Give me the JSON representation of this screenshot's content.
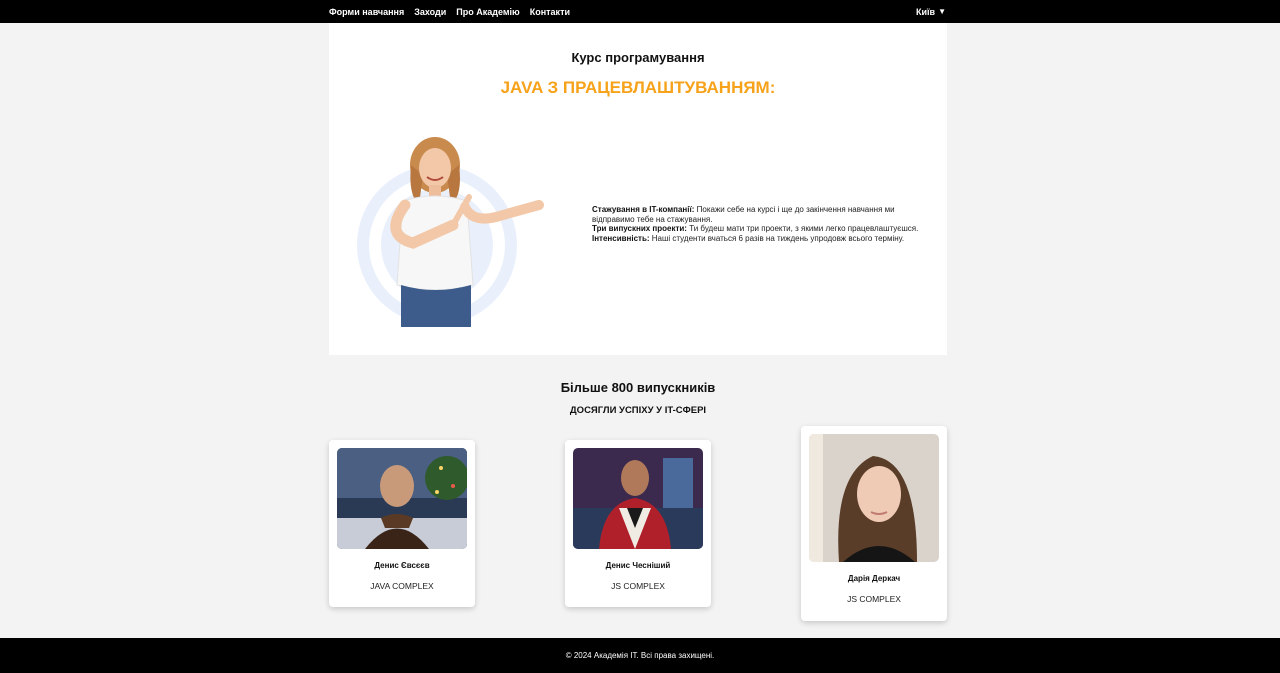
{
  "nav": {
    "items": [
      "Форми навчання",
      "Заходи",
      "Про Академію",
      "Контакти"
    ],
    "city": "Київ",
    "caret": "▼"
  },
  "hero": {
    "subtitle": "Курс програмування",
    "title": "JAVA З ПРАЦЕВЛАШТУВАННЯМ:",
    "features": [
      {
        "label": "Стажування в IT-компанії:",
        "text": " Покажи себе на курсі і ще до закінчення навчання ми відправимо тебе на стажування."
      },
      {
        "label": "Три випускних проекти:",
        "text": " Ти будеш мати три проекти, з якими легко працевлаштуєшся."
      },
      {
        "label": "Інтенсивність:",
        "text": " Наші студенти вчаться 6 разів на тиждень упродовж всього терміну."
      }
    ]
  },
  "graduates": {
    "title": "Більше 800 випускників",
    "subtitle": "ДОСЯГЛИ УСПІХУ У IT-СФЕРІ",
    "cards": [
      {
        "name": "Денис Євсєєв",
        "course": "JAVA COMPLEX"
      },
      {
        "name": "Денис Чесніший",
        "course": "JS COMPLEX"
      },
      {
        "name": "Дарія Деркач",
        "course": "JS COMPLEX"
      }
    ]
  },
  "footer": {
    "text": "© 2024 Академія IT. Всі права захищені."
  },
  "colors": {
    "accent": "#f6a21a",
    "nav_bg": "#000000",
    "page_bg": "#f3f3f3"
  }
}
